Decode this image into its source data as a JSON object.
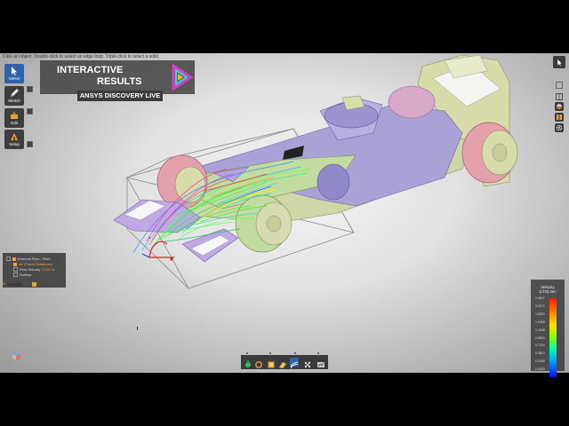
{
  "status_hint": "Click an object. Double-click to select an edge loop. Triple-click to select a solid.",
  "banner": {
    "line1": "INTERACTIVE",
    "line2": "RESULTS",
    "subtitle": "ANSYS DISCOVERY LIVE"
  },
  "toolbar_left": [
    {
      "label": "Select",
      "icon": "cursor-icon",
      "active": true
    },
    {
      "label": "Sketch",
      "icon": "pencil-icon",
      "active": false
    },
    {
      "label": "Edit",
      "icon": "edit-icon",
      "active": false
    },
    {
      "label": "Setup",
      "icon": "setup-icon",
      "active": false
    }
  ],
  "tree": {
    "root": "External Flow - Fluid",
    "child1": "Air (Fluent Database)",
    "child2_label": "Flow Velocity",
    "child2_value": "2.103",
    "child3": "Outflow",
    "solution": "Solution"
  },
  "legend": {
    "title_line1": "Velocity",
    "title_line2": "(LTS) sec",
    "ticks": [
      "2.4547",
      "2.0272",
      "1.8920",
      "1.6408",
      "1.2248",
      "0.8834",
      "0.7224",
      "0.4813",
      "0.2405",
      "0.0000"
    ]
  },
  "colors": {
    "accent": "#2f62a8",
    "panel": "#3c3c3c",
    "highlight": "#f0a040"
  }
}
